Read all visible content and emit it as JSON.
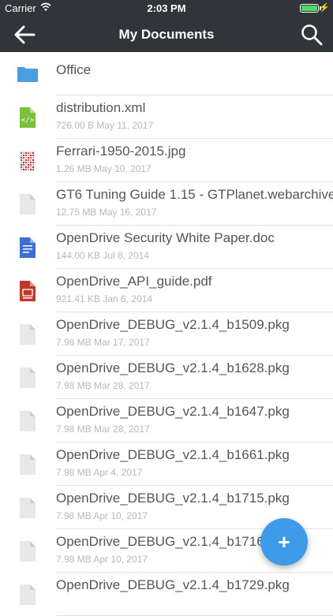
{
  "status_bar": {
    "carrier": "Carrier",
    "time": "2:03 PM"
  },
  "navbar": {
    "title": "My Documents",
    "back_icon": "back-arrow-icon",
    "search_icon": "search-icon"
  },
  "items": [
    {
      "name": "Office",
      "meta": "",
      "type": "folder"
    },
    {
      "name": "distribution.xml",
      "meta": "726.00 B May 11, 2017",
      "type": "xml"
    },
    {
      "name": "Ferrari-1950-2015.jpg",
      "meta": "1.26 MB May 10, 2017",
      "type": "jpg"
    },
    {
      "name": "GT6 Tuning Guide 1.15 - GTPlanet.webarchive",
      "meta": "12.75 MB May 16, 2017",
      "type": "generic"
    },
    {
      "name": "OpenDrive Security White Paper.doc",
      "meta": "144.00 KB Jul 8, 2014",
      "type": "doc"
    },
    {
      "name": "OpenDrive_API_guide.pdf",
      "meta": "921.41 KB Jan 6, 2014",
      "type": "pdf"
    },
    {
      "name": "OpenDrive_DEBUG_v2.1.4_b1509.pkg",
      "meta": "7.98 MB Mar 17, 2017",
      "type": "generic"
    },
    {
      "name": "OpenDrive_DEBUG_v2.1.4_b1628.pkg",
      "meta": "7.98 MB Mar 28, 2017",
      "type": "generic"
    },
    {
      "name": "OpenDrive_DEBUG_v2.1.4_b1647.pkg",
      "meta": "7.98 MB Mar 28, 2017",
      "type": "generic"
    },
    {
      "name": "OpenDrive_DEBUG_v2.1.4_b1661.pkg",
      "meta": "7.98 MB Apr 4, 2017",
      "type": "generic"
    },
    {
      "name": "OpenDrive_DEBUG_v2.1.4_b1715.pkg",
      "meta": "7.98 MB Apr 10, 2017",
      "type": "generic"
    },
    {
      "name": "OpenDrive_DEBUG_v2.1.4_b1716.pkg",
      "meta": "7.98 MB Apr 10, 2017",
      "type": "generic"
    },
    {
      "name": "OpenDrive_DEBUG_v2.1.4_b1729.pkg",
      "meta": "",
      "type": "generic"
    }
  ],
  "fab": {
    "label": "+"
  },
  "colors": {
    "navbar": "#2f3539",
    "accent": "#3d9be9",
    "folder": "#4a9fe0",
    "xml": "#7cbf3a",
    "doc": "#3b6fd0",
    "pdf": "#c0392b"
  }
}
